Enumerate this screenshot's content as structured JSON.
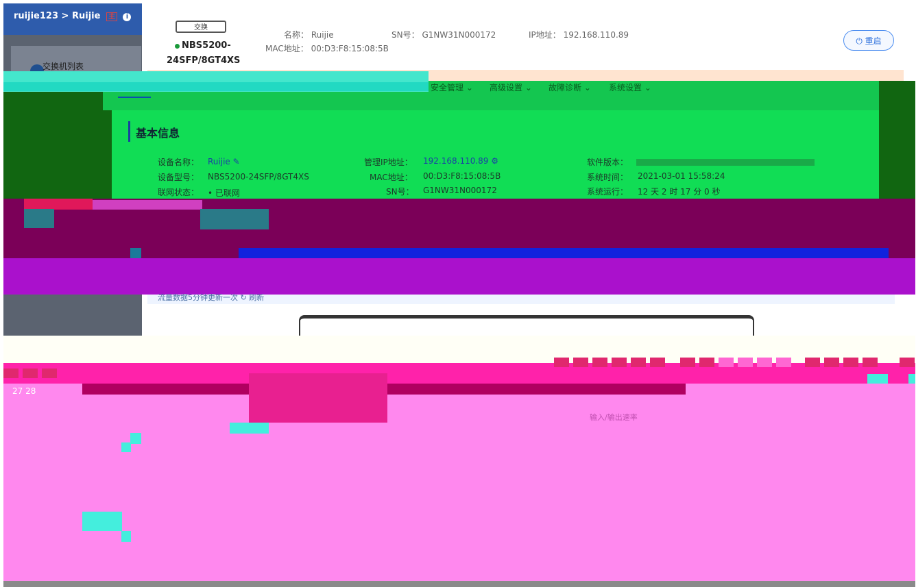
{
  "sidebar": {
    "breadcrumb_account": "ruijie123",
    "breadcrumb_separator": ">",
    "breadcrumb_site": "Ruijie",
    "breadcrumb_tag": "主",
    "switch_list_label": "交换机列表"
  },
  "device": {
    "thumb_label": "交换",
    "model_line1": "NBS5200-",
    "model_line2": "24SFP/8GT4XS",
    "name_label": "名称：",
    "name_value": "Ruijie",
    "sn_label": "SN号：",
    "sn_value": "G1NW31N000172",
    "ip_label": "IP地址：",
    "ip_value": "192.168.110.89",
    "mac_label": "MAC地址：",
    "mac_value": "00:D3:F8:15:08:5B",
    "restart_label": "重启",
    "status_color": "#1a9a3a"
  },
  "tabs": [
    {
      "label": "安全管理 ⌄"
    },
    {
      "label": "高级设置 ⌄"
    },
    {
      "label": "故障诊断 ⌄"
    },
    {
      "label": "系统设置 ⌄"
    }
  ],
  "basic_info": {
    "title": "基本信息",
    "device_name_label": "设备名称：",
    "device_name_value": "Ruijie",
    "device_model_label": "设备型号：",
    "device_model_value": "NBS5200-24SFP/8GT4XS",
    "network_status_label": "联网状态：",
    "network_status_value": "已联网",
    "mgmt_ip_label": "管理IP地址：",
    "mgmt_ip_value": "192.168.110.89",
    "mac_label": "MAC地址：",
    "mac_value": "00:D3:F8:15:08:5B",
    "sn_label": "SN号：",
    "sn_value": "G1NW31N000172",
    "software_version_label": "软件版本：",
    "system_time_label": "系统时间：",
    "system_time_value": "2021-03-01 15:58:24",
    "uptime_label": "系统运行：",
    "uptime_value": "12 天 2 时 17 分 0 秒"
  },
  "panel": {
    "update_note": "流量数据5分钟更新一次 ↻ 刷新",
    "port_numbers": "27   28",
    "io_rate_header": "输入/输出速率"
  },
  "colors": {
    "sidebar_header": "#2e5cac",
    "accent_blue": "#2b6fdc",
    "online_green": "#1a9a3a"
  }
}
